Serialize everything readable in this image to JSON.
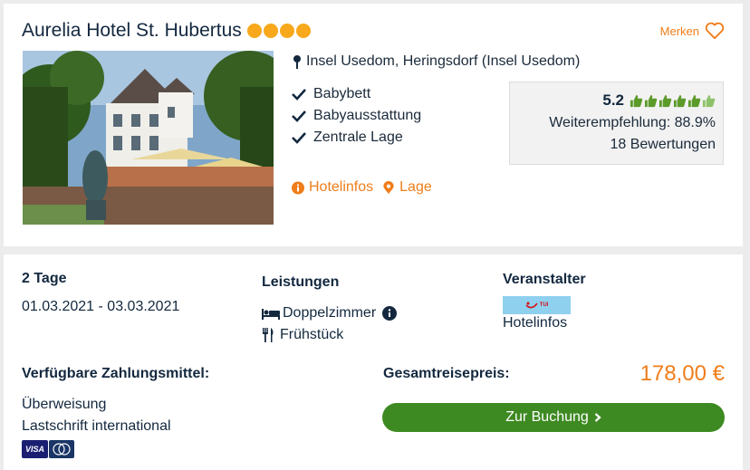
{
  "hotel": {
    "name": "Aurelia Hotel St. Hubertus",
    "stars": 4,
    "star_color": "#f7a81b",
    "bookmark_label": "Merken",
    "location": "Insel Usedom, Heringsdorf (Insel Usedom)",
    "features": [
      "Babybett",
      "Babyausstattung",
      "Zentrale Lage"
    ],
    "links": {
      "info": "Hotelinfos",
      "location": "Lage"
    }
  },
  "rating": {
    "score": "5.2",
    "thumbs_total": 6,
    "thumbs_filled": 5.2,
    "recommendation": "Weiterempfehlung: 88.9%",
    "reviews": "18 Bewertungen"
  },
  "trip": {
    "duration": "2 Tage",
    "dates": "01.03.2021 - 03.03.2021"
  },
  "services": {
    "heading": "Leistungen",
    "room": "Doppelzimmer",
    "board": "Frühstück"
  },
  "operator": {
    "heading": "Veranstalter",
    "logo_text": "TUI",
    "link": "Hotelinfos"
  },
  "payment": {
    "heading": "Verfügbare Zahlungsmittel:",
    "methods": [
      "Überweisung",
      "Lastschrift international"
    ],
    "card_logos": [
      "VISA",
      "Mastercard"
    ]
  },
  "total": {
    "label": "Gesamtreisepreis:",
    "price": "178,00 €",
    "button": "Zur Buchung"
  },
  "colors": {
    "accent": "#ef7d1a",
    "button_green": "#3e8a22",
    "thumb_green": "#5c9a2a",
    "text_dark": "#13283f"
  }
}
